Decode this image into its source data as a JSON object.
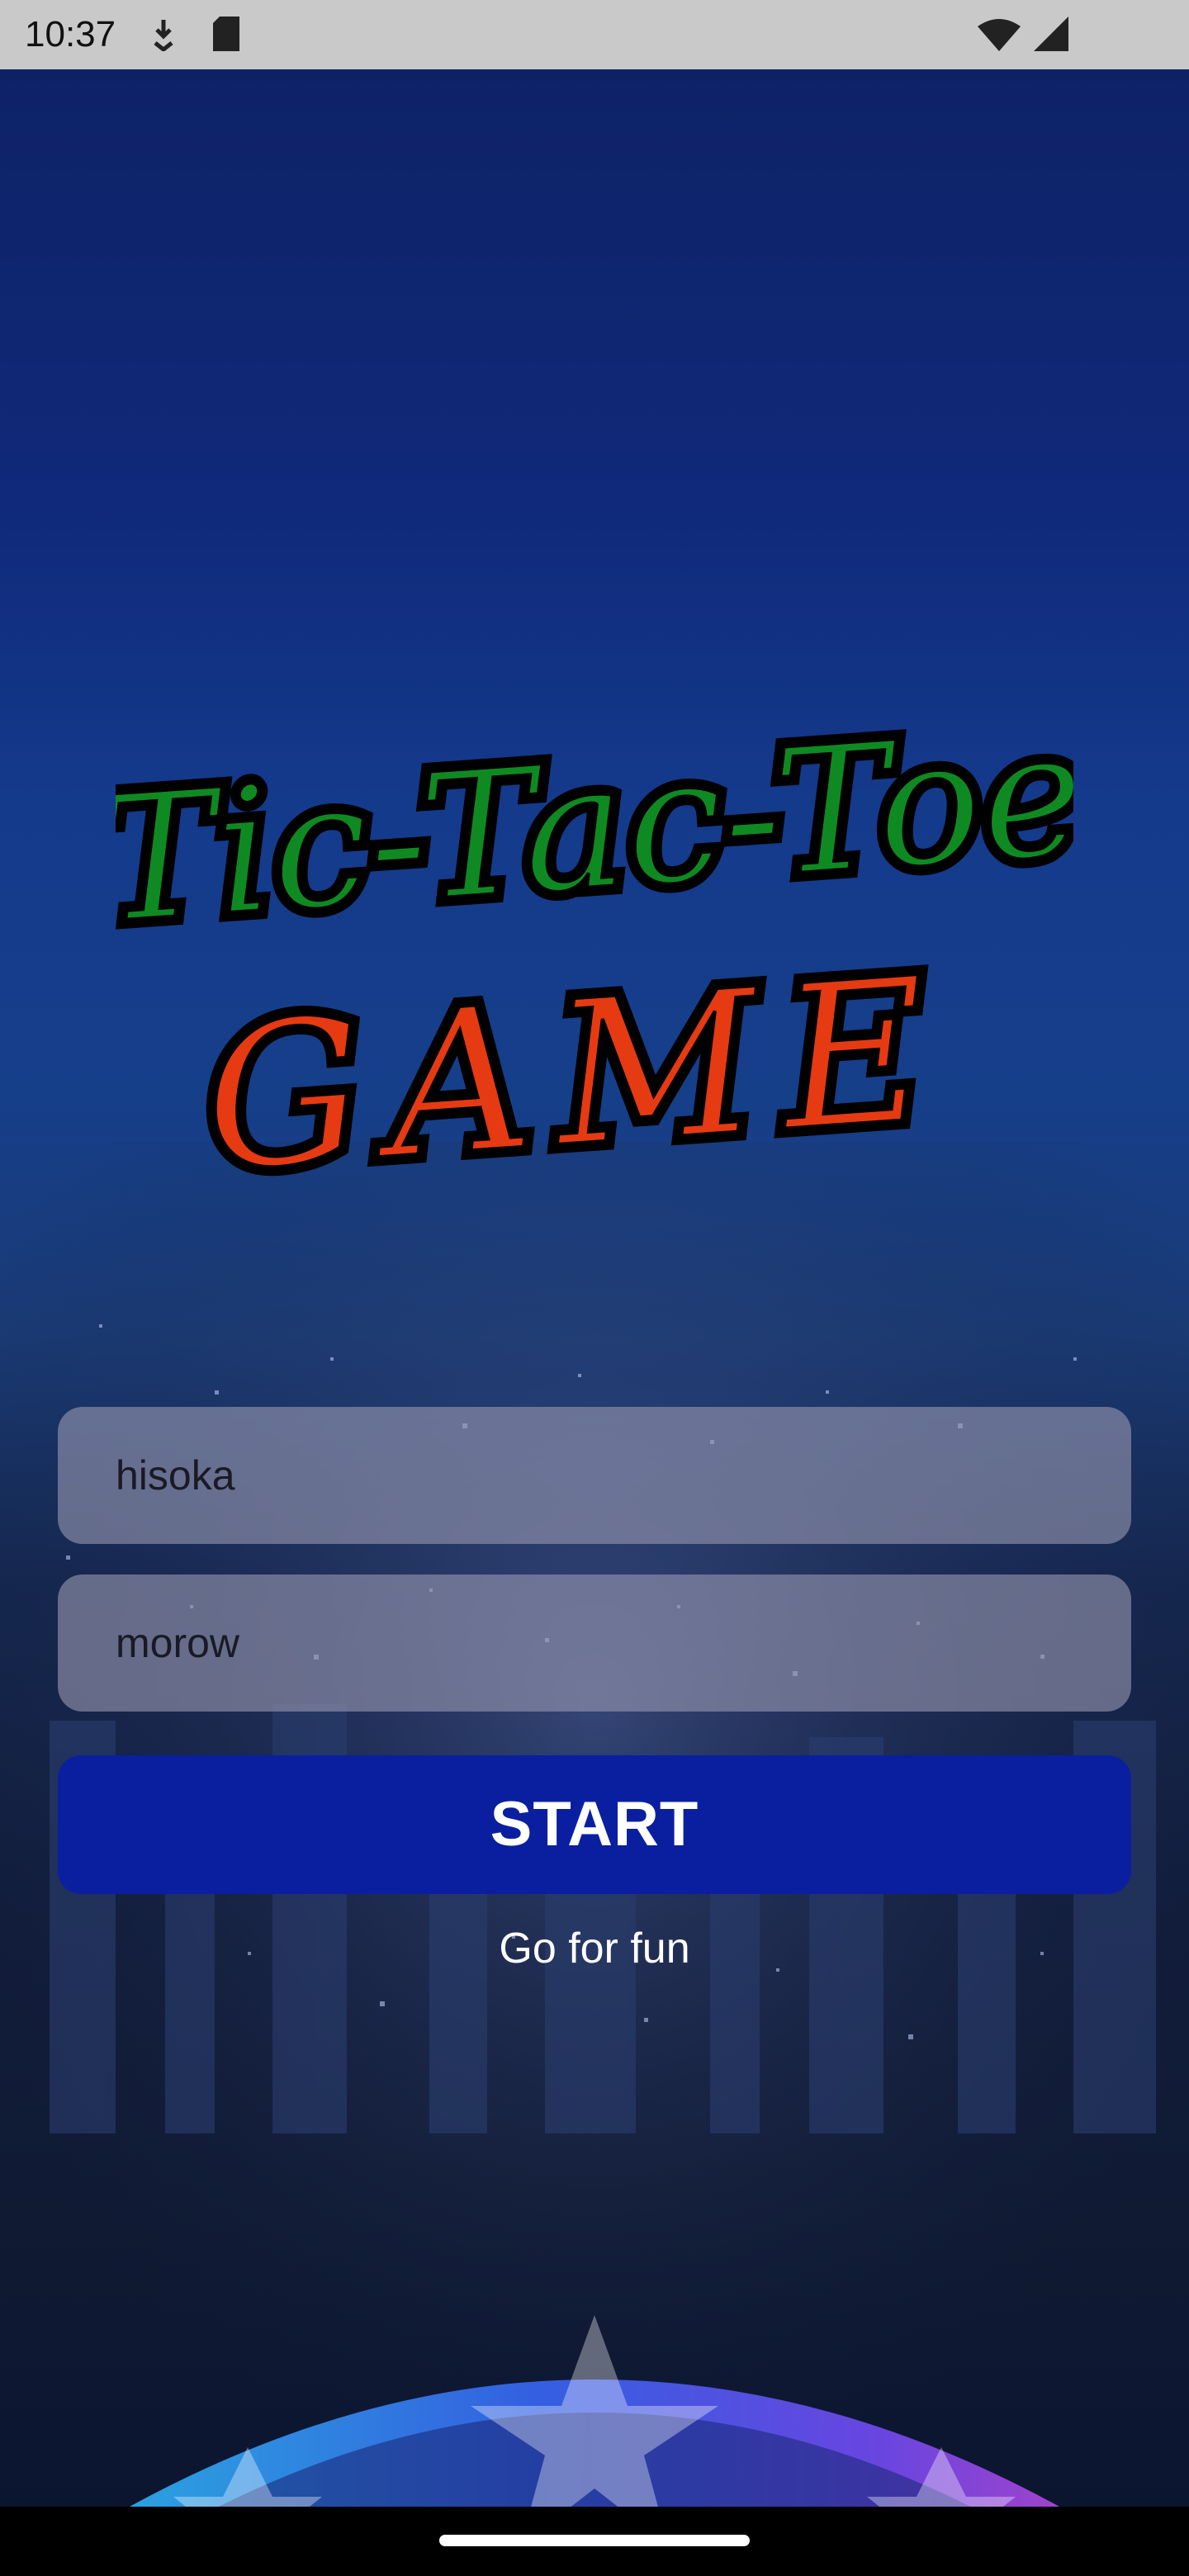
{
  "status_bar": {
    "time": "10:37",
    "icons": [
      "download-icon",
      "sd-card-icon",
      "wifi-icon",
      "signal-icon"
    ]
  },
  "logo": {
    "line1": "Tic-Tac-Toe",
    "line2": "GAME",
    "line1_color": "#1a9a2a",
    "line2_color": "#e63a12"
  },
  "form": {
    "player1_value": "hisoka",
    "player2_value": "morow",
    "start_label": "START",
    "tagline": "Go for fun"
  },
  "colors": {
    "start_button": "#0a1fa0",
    "input_background": "#9696af"
  }
}
